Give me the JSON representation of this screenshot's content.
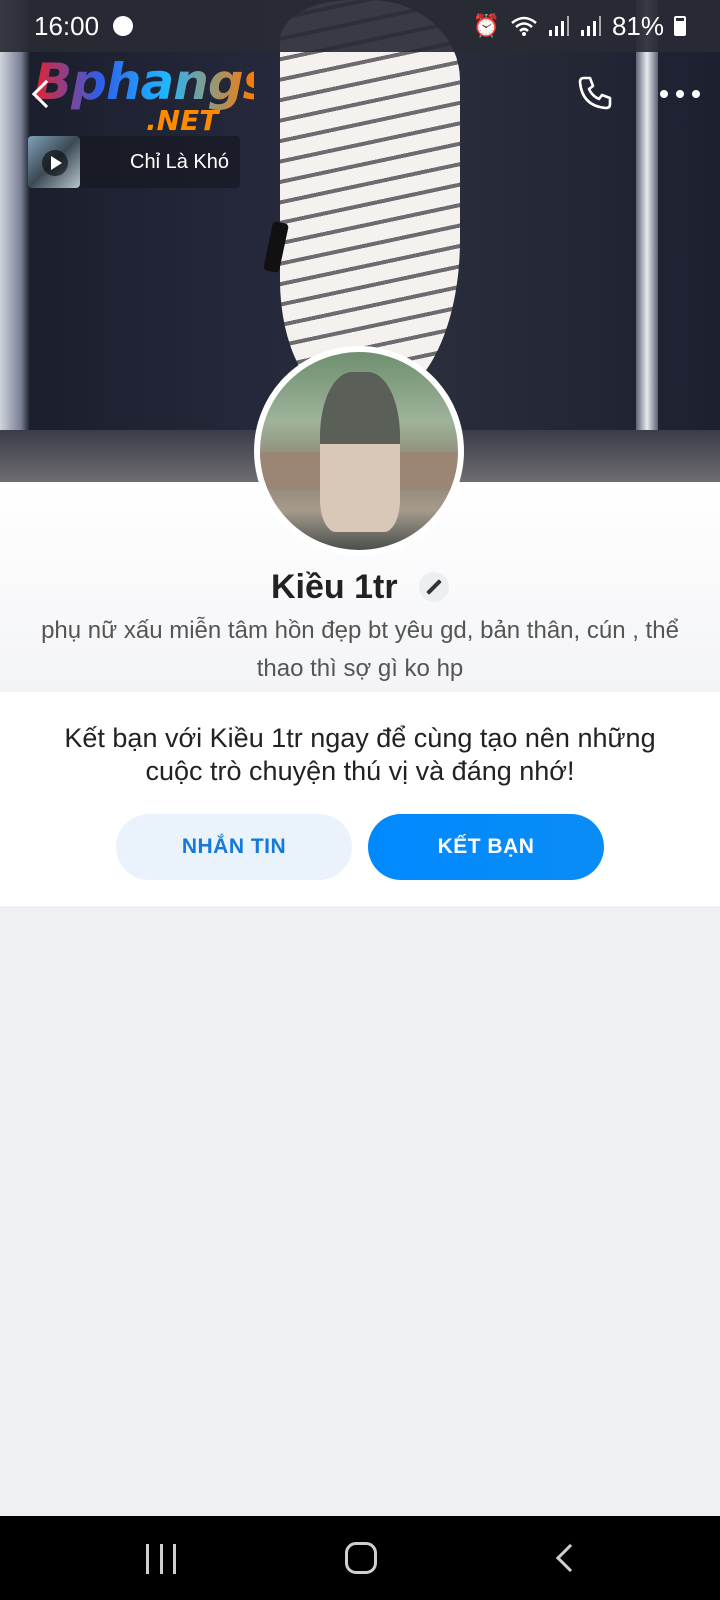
{
  "status_bar": {
    "time": "16:00",
    "battery": "81%",
    "icons": [
      "alarm-icon",
      "wifi-icon",
      "signal-icon",
      "signal-icon",
      "battery-icon"
    ]
  },
  "watermark": {
    "name": "Bphangs",
    "suffix": ".NET"
  },
  "header": {
    "icons": [
      "back-icon",
      "phone-icon",
      "more-icon"
    ]
  },
  "music": {
    "title": "Chỉ Là Khó"
  },
  "profile": {
    "name": "Kiều 1tr",
    "bio": "phụ nữ xấu miễn tâm hồn đẹp bt yêu gd, bản thân, cún , thể thao thì sợ gì ko hp"
  },
  "invite": {
    "text": "Kết bạn với Kiều 1tr ngay để cùng tạo nên những cuộc trò chuyện thú vị và đáng nhớ!",
    "message_label": "NHẮN TIN",
    "add_friend_label": "KẾT BẠN"
  },
  "nav_bar": {
    "icons": [
      "recents-icon",
      "home-icon",
      "back-icon"
    ]
  },
  "colors": {
    "accent": "#0089ff",
    "message_button_bg": "#eaf3fb",
    "page_background": "#eef0f3"
  }
}
